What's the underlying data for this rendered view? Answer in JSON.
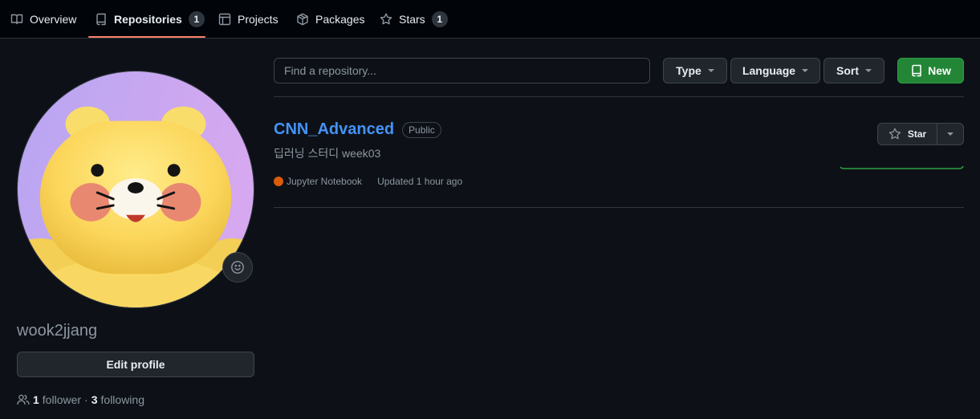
{
  "tabs": [
    {
      "label": "Overview",
      "icon": "book-icon"
    },
    {
      "label": "Repositories",
      "icon": "repo-icon",
      "count": "1",
      "selected": true
    },
    {
      "label": "Projects",
      "icon": "table-icon"
    },
    {
      "label": "Packages",
      "icon": "package-icon"
    },
    {
      "label": "Stars",
      "icon": "star-icon",
      "count": "1"
    }
  ],
  "profile": {
    "username": "wook2jjang",
    "edit_label": "Edit profile",
    "followers_count": "1",
    "followers_label": "follower",
    "separator": "·",
    "following_count": "3",
    "following_label": "following"
  },
  "filters": {
    "search_placeholder": "Find a repository...",
    "type_label": "Type",
    "language_label": "Language",
    "sort_label": "Sort",
    "new_label": "New"
  },
  "repo": {
    "name": "CNN_Advanced",
    "visibility": "Public",
    "description": "딥러닝 스터디 week03",
    "language": "Jupyter Notebook",
    "language_color": "#DA5B0B",
    "updated": "Updated 1 hour ago",
    "star_label": "Star"
  },
  "colors": {
    "accent": "#4493f8",
    "tab_underline": "#f78166",
    "new_button": "#238636",
    "activity_graph": "#2ea043"
  }
}
